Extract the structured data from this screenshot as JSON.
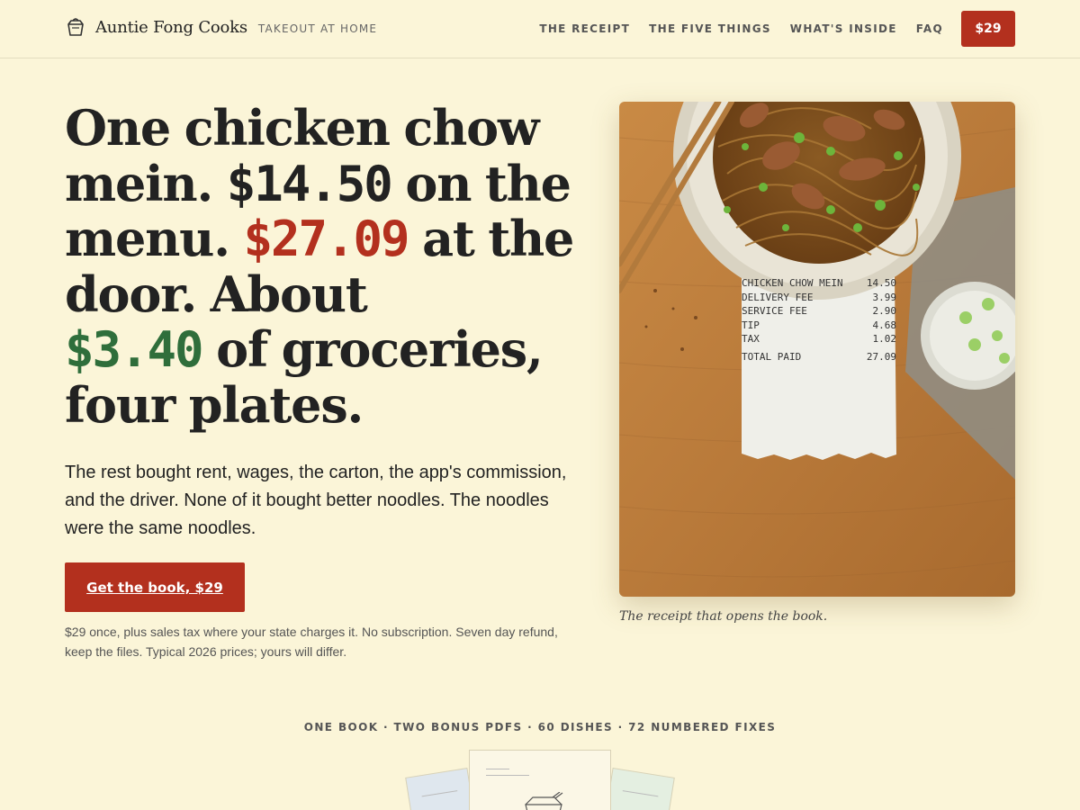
{
  "header": {
    "brand_name": "Auntie Fong Cooks",
    "brand_tag": "TAKEOUT AT HOME",
    "brand_icon": "takeout-box-icon",
    "nav": [
      {
        "label": "THE RECEIPT"
      },
      {
        "label": "THE FIVE THINGS"
      },
      {
        "label": "WHAT'S INSIDE"
      },
      {
        "label": "FAQ"
      }
    ],
    "price_button": "$29"
  },
  "hero": {
    "title_a": "One chicken chow mein.",
    "title_menu_price": "$14.50",
    "title_b": "on the menu.",
    "title_door_price": "$27.09",
    "title_c": "at the door. About",
    "title_grocery_price": "$3.40",
    "title_d": "of groceries, four plates.",
    "subtitle": "The rest bought rent, wages, the carton, the app's commission, and the driver. None of it bought better noodles. The noodles were the same noodles.",
    "cta_label": "Get the book, $29",
    "fineprint": "$29 once, plus sales tax where your state charges it. No subscription. Seven day refund, keep the files. Typical 2026 prices; yours will differ."
  },
  "photo": {
    "receipt_lines": [
      {
        "item": "CHICKEN CHOW MEIN",
        "amount": "14.50"
      },
      {
        "item": "DELIVERY FEE",
        "amount": "3.99"
      },
      {
        "item": "SERVICE FEE",
        "amount": "2.90"
      },
      {
        "item": "TIP",
        "amount": "4.68"
      },
      {
        "item": "TAX",
        "amount": "1.02"
      }
    ],
    "receipt_total": {
      "item": "TOTAL PAID",
      "amount": "27.09"
    },
    "caption": "The receipt that opens the book."
  },
  "bundle": {
    "line": "ONE BOOK · TWO BONUS PDFS · 60 DISHES · 72 NUMBERED FIXES"
  },
  "colors": {
    "background": "#fbf5d8",
    "accent_red": "#b3301e",
    "accent_green": "#2f6e3b",
    "text": "#222222"
  }
}
